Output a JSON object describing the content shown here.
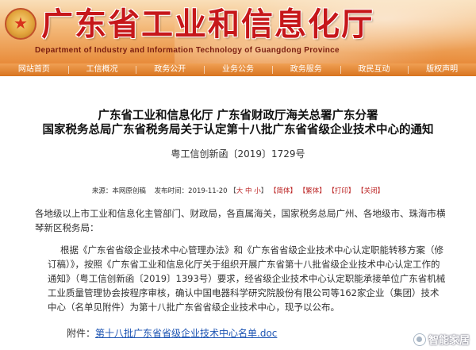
{
  "header": {
    "title": "广东省工业和信息化厅",
    "subtitle": "Department of Industry and Information Technology of Guangdong Province"
  },
  "nav": {
    "items": [
      {
        "label": "网站首页"
      },
      {
        "label": "工信概况"
      },
      {
        "label": "政务公开"
      },
      {
        "label": "业务公务"
      },
      {
        "label": "政务服务"
      },
      {
        "label": "政民互动"
      },
      {
        "label": "版权声明"
      }
    ]
  },
  "article": {
    "title_line1": "广东省工业和信息化厅 广东省财政厅海关总署广东分署",
    "title_line2": "国家税务总局广东省税务局关于认定第十八批广东省省级企业技术中心的通知",
    "doc_number": "粤工信创新函〔2019〕1729号",
    "meta": {
      "source": "来源：本网原创稿",
      "date": "发布时间：2019-11-20",
      "font_size_open": "【",
      "font_large": "大",
      "font_medium": "中",
      "font_small": "小",
      "font_size_close": "】",
      "simplified": "【简体】",
      "traditional": "【繁体】",
      "print": "【打印】",
      "close": "【关闭】"
    },
    "para1": "各地级以上市工业和信息化主管部门、财政局，各直属海关，国家税务总局广州、各地级市、珠海市横琴新区税务局：",
    "para2": "根据《广东省省级企业技术中心管理办法》和《广东省省级企业技术中心认定职能转移方案（修订稿）》，按照《广东省工业和信息化厅关于组织开展广东省第十八批省级企业技术中心认定工作的通知》（粤工信创新函〔2019〕1393号）要求，经省级企业技术中心认定职能承接单位广东省机械工业质量管理协会按程序审核，确认中国电器科学研究院股份有限公司等162家企业（集团）技术中心（名单见附件）为第十八批广东省省级企业技术中心，现予以公布。",
    "attachment_label": "附件：",
    "attachment_file": "第十八批广东省省级企业技术中心名单.doc"
  },
  "watermark": {
    "text": "智能家居"
  },
  "colors": {
    "title_red": "#c6171a",
    "nav_orange": "#d8741f",
    "link_blue": "#1e55b3"
  }
}
